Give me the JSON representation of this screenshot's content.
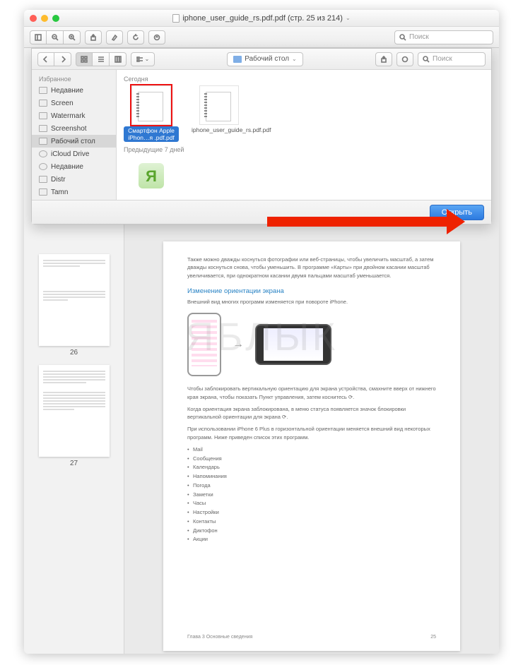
{
  "window": {
    "title": "iphone_user_guide_rs.pdf.pdf (стр. 25 из 214)",
    "dropdown_glyph": "⌄"
  },
  "toolbar": {
    "search_placeholder": "Поиск"
  },
  "sheet": {
    "path_label": "Рабочий стол",
    "search_placeholder": "Поиск",
    "open_label": "Открыть"
  },
  "sidebar": {
    "heading": "Избранное",
    "items": [
      {
        "label": "Недавние"
      },
      {
        "label": "Screen"
      },
      {
        "label": "Watermark"
      },
      {
        "label": "Screenshot"
      },
      {
        "label": "Рабочий стол"
      },
      {
        "label": "iCloud Drive"
      },
      {
        "label": "Недавние"
      },
      {
        "label": "Distr"
      },
      {
        "label": "Tamn"
      }
    ]
  },
  "files": {
    "section_today": "Сегодня",
    "section_prev7": "Предыдущие 7 дней",
    "items": [
      {
        "label": "Смартфон Apple iPhon…я .pdf.pdf"
      },
      {
        "label": "iphone_user_guide_rs.pdf.pdf"
      }
    ],
    "app_label": ""
  },
  "thumbs": [
    {
      "label": "26"
    },
    {
      "label": "27"
    }
  ],
  "doc": {
    "para1": "Также можно дважды коснуться фотографии или веб-страницы, чтобы увеличить масштаб, а затем дважды коснуться снова, чтобы уменьшить. В программе «Карты» при двойном касании масштаб увеличивается, при однократном касании двумя пальцами масштаб уменьшается.",
    "h1": "Изменение ориентации экрана",
    "para2": "Внешний вид многих программ изменяется при повороте iPhone.",
    "para3": "Чтобы заблокировать вертикальную ориентацию для экрана устройства, смахните вверх от нижнего края экрана, чтобы показать Пункт управления, затем коснитесь ⟳.",
    "para4": "Когда ориентация экрана заблокирована, в меню статуса появляется значок блокировки вертикальной ориентации для экрана ⟳.",
    "para5": "При использовании iPhone 6 Plus в горизонтальной ориентации меняется внешний вид некоторых программ. Ниже приведен список этих программ.",
    "bullets": [
      "Mail",
      "Сообщения",
      "Календарь",
      "Напоминания",
      "Погода",
      "Заметки",
      "Часы",
      "Настройки",
      "Контакты",
      "Диктофон",
      "Акции"
    ],
    "footer_left": "Глава 3    Основные сведения",
    "footer_right": "25"
  },
  "watermark": "ЯБЛЫК"
}
